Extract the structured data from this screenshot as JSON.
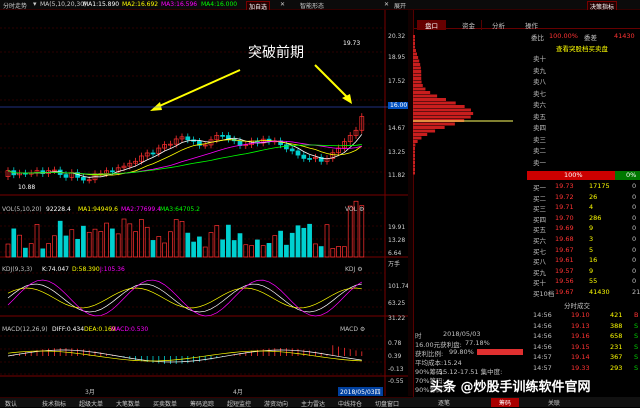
{
  "toolbar": {
    "dropdown": "分时走势",
    "indicator_set": "MA(5,10,20,30)",
    "ma1": "MA1:15.890",
    "ma2": "MA2:16.692",
    "ma3": "MA3:16.596",
    "ma4": "MA4:16.000",
    "btn_add": "加自选",
    "btn_alarm": "智能形态",
    "btn_expand": "展开",
    "btn_decision": "决策指标"
  },
  "annotation": {
    "text": "突破前期"
  },
  "price_axis": [
    "20.32",
    "18.95",
    "17.52",
    "16.00",
    "14.67",
    "13.25",
    "11.82"
  ],
  "labels": {
    "high": "19.73",
    "low": "10.88",
    "cur_price": "16.00"
  },
  "vol": {
    "title": "VOL(5,10,20)",
    "v1": "92228.4",
    "v2": "MA1:94949.6",
    "v3": "MA2:77699.4",
    "v4": "MA3:64705.2",
    "axis": [
      "19.91",
      "13.28",
      "6.64",
      "万手"
    ]
  },
  "kdj": {
    "title": "KDJ(9,3,3)",
    "k": "K:74.047",
    "d": "D:58.390",
    "j": "J:105.36",
    "axis": [
      "101.74",
      "63.25",
      "31.22"
    ]
  },
  "macd": {
    "title": "MACD(12,26,9)",
    "diff": "DIFF:0.434",
    "dea": "DEA:0.169",
    "macd": "MACD:0.530",
    "axis": [
      "0.78",
      "0.39",
      "-0.13",
      "-0.55"
    ]
  },
  "months": [
    "3月",
    "4月"
  ],
  "date_badge": "2018/05/03四",
  "bottom_tabs": [
    "数认",
    "技术指标",
    "超级大单",
    "大笔数单",
    "买卖数单",
    "筹码追踪",
    "超短监控",
    "游资动向",
    "主力雷达",
    "中线持仓",
    "切盘窗口"
  ],
  "panel": {
    "tabs": [
      "盘口",
      "资金",
      "分析",
      "操作"
    ],
    "webi": "委比",
    "webi_val": "100.00%",
    "weicha": "委差",
    "weicha_val": "41430",
    "title": "查看突股档买卖盘",
    "sells": [
      "卖十",
      "卖九",
      "卖八",
      "卖七",
      "卖六",
      "卖五",
      "卖四",
      "卖三",
      "卖二",
      "卖一"
    ],
    "ratio": "100%",
    "ratio2": "0%",
    "buys": [
      [
        "买一",
        "19.73",
        "17175",
        "0"
      ],
      [
        "买二",
        "19.72",
        "26",
        "0"
      ],
      [
        "买三",
        "19.71",
        "4",
        "0"
      ],
      [
        "买四",
        "19.70",
        "286",
        "0"
      ],
      [
        "买五",
        "19.69",
        "9",
        "0"
      ],
      [
        "买六",
        "19.68",
        "3",
        "0"
      ],
      [
        "买七",
        "19.67",
        "5",
        "0"
      ],
      [
        "买八",
        "19.61",
        "16",
        "0"
      ],
      [
        "买九",
        "19.57",
        "9",
        "0"
      ],
      [
        "买十",
        "19.56",
        "55",
        "0"
      ],
      [
        "买10档",
        "19.67",
        "41430",
        "21"
      ]
    ],
    "trade_title": "分时成交",
    "trades": [
      [
        "14:56",
        "19.10",
        "421",
        "B"
      ],
      [
        "14:56",
        "19.13",
        "388",
        "S"
      ],
      [
        "14:56",
        "19.16",
        "658",
        "S"
      ],
      [
        "14:56",
        "19.15",
        "231",
        "S"
      ],
      [
        "14:57",
        "19.14",
        "367",
        "S"
      ],
      [
        "14:57",
        "19.33",
        "293",
        "S"
      ]
    ]
  },
  "chip": {
    "date": "2018/05/03",
    "label_time": "时",
    "l1": "16.00元获利盘:",
    "l1v": "77.18%",
    "l2": "获利比例:",
    "l2v": "99.80%",
    "l3": "平均成本:15.24",
    "l4": "90%筹码:",
    "l4v": "15.12-17.51 集中度:",
    "l5": "70%筹码:",
    "l6": "90%筹码:"
  },
  "watermark": "头条 @炒股手训练软件官网",
  "side_bottom": [
    "逐笔",
    "筹码",
    "关联"
  ],
  "colors": {
    "up": "#ff3030",
    "down": "#00d0d0",
    "ma5": "#ffffff",
    "ma10": "#ffff00",
    "ma20": "#ff00ff",
    "ma30": "#00ff00",
    "arrow": "#ffff00"
  }
}
